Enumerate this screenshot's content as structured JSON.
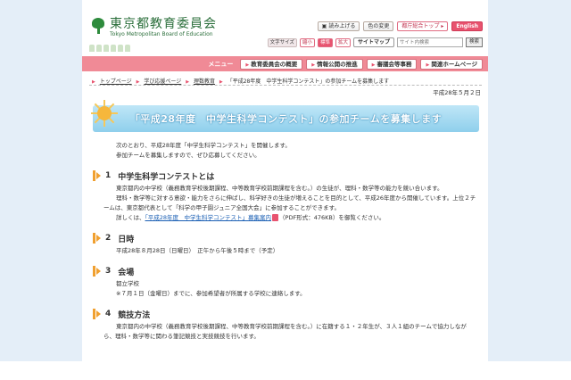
{
  "header": {
    "logo_jp": "東京都教育委員会",
    "logo_en": "Tokyo Metropolitan Board of Education",
    "tools": {
      "read_aloud": "読み上げる",
      "color_change": "色の変更",
      "top_portal": "都庁総合トップ",
      "english": "English",
      "text_size_label": "文字サイズ",
      "size_small": "縮小",
      "size_standard": "標準",
      "size_large": "拡大",
      "sitemap": "サイトマップ",
      "search_placeholder": "サイト内検索",
      "search_button": "検索"
    }
  },
  "nav": {
    "menu_label": "メニュー",
    "items": [
      "教育委員会の概要",
      "情報公開の推進",
      "審議会等事務",
      "関連ホームページ"
    ]
  },
  "breadcrumb": {
    "items": [
      "トップページ",
      "学び応援ページ",
      "理数教育"
    ],
    "current": "「平成28年度　中学生科学コンテスト」の参加チームを募集します"
  },
  "date": "平成28年５月２日",
  "title": "「平成28年度　中学生科学コンテスト」の参加チームを募集します",
  "intro": [
    "次のとおり、平成28年度「中学生科学コンテスト」を開催します。",
    "参加チームを募集しますので、ぜひ応募してください。"
  ],
  "sections": [
    {
      "num": "1",
      "title": "中学生科学コンテストとは",
      "lines": [
        "東京都内の中学校（義務教育学校後期課程、中等教育学校前期課程を含む。）の生徒が、理科・数学等の能力を競い合います。",
        "理科・数学等に対する意欲・能力をさらに伸ばし、科学好きの生徒が増えることを目的として、平成26年度から開催しています。上位２チームは、東京都代表として「科学の甲子園ジュニア全国大会」に参加することができます。"
      ],
      "detail_prefix": "詳しくは、",
      "detail_link": "「平成28年度　中学生科学コンテスト」募集案内",
      "detail_suffix": "（PDF形式：476KB）を御覧ください。"
    },
    {
      "num": "2",
      "title": "日時",
      "lines": [
        "平成28年８月28日（日曜日）　正午から午後５時まで（予定）"
      ]
    },
    {
      "num": "3",
      "title": "会場",
      "lines": [
        "都立学校",
        "※７月１日（金曜日）までに、参加希望者が所属する学校に連絡します。"
      ]
    },
    {
      "num": "4",
      "title": "競技方法",
      "lines": [
        "東京都内の中学校（義務教育学校後期課程、中等教育学校前期課程を含む。）に在籍する１・２年生が、３人１組のチームで協力しながら、理科・数学等に関わる筆記競技と実技競技を行います。"
      ]
    }
  ],
  "colors": {
    "nav_pink": "#f08a96",
    "accent_pink": "#e8536f",
    "banner_blue": "#8fcfec",
    "section_orange": "#f0a030",
    "logo_green": "#2a6e3a",
    "side_blue": "#e4eef8"
  }
}
